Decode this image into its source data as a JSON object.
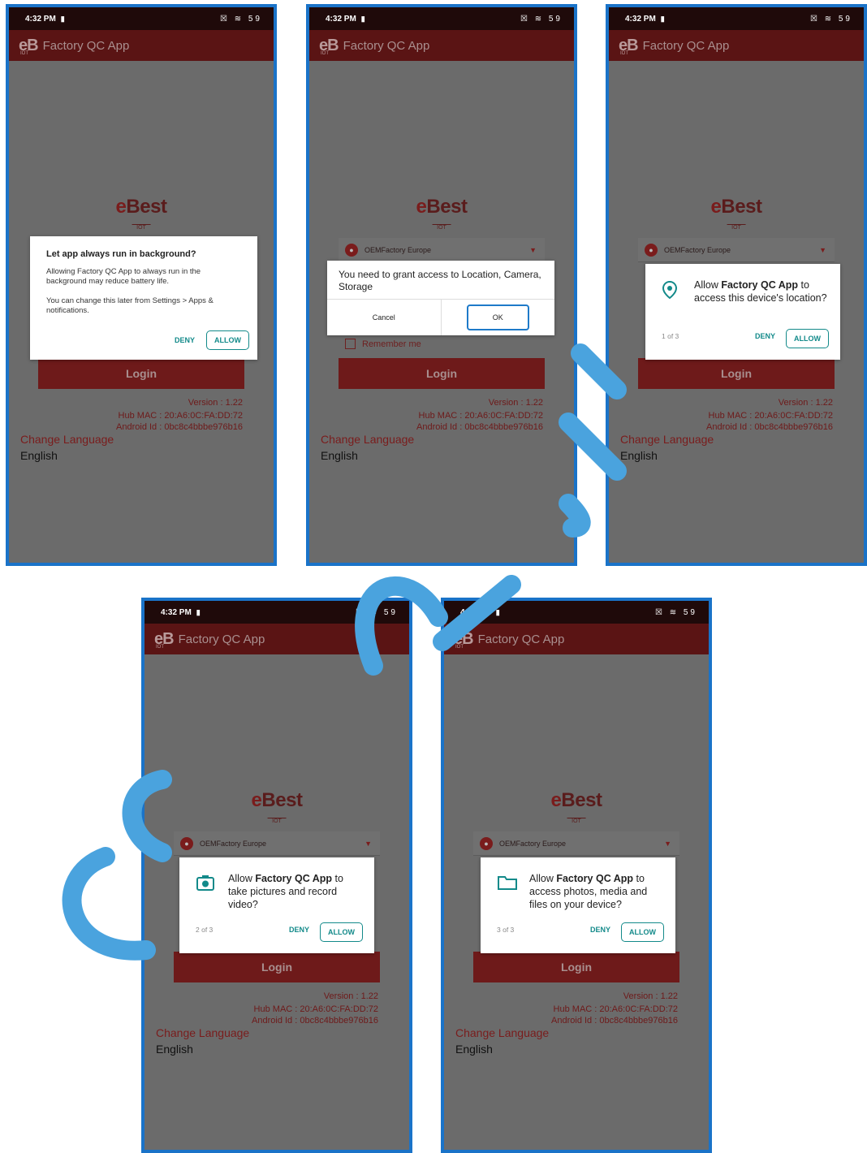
{
  "colors": {
    "frame": "#1a73c8",
    "appbar": "#5a1414",
    "accent": "#7a1c1c",
    "teal": "#138a8a",
    "watermark": "#4aa3de"
  },
  "phones": [
    {
      "time": "4:32 PM",
      "status_icons": "☒ ≋ 59",
      "app_title": "Factory QC App",
      "logo_text": "eBest",
      "logo_sub": "IOT",
      "login_label": "Login",
      "version": "Version : 1.22",
      "hub_mac": "Hub MAC : 20:A6:0C:FA:DD:72",
      "android_id": "Android Id : 0bc8c4bbbe976b16",
      "change_language": "Change Language",
      "language": "English",
      "dialog": {
        "title": "Let app always run in background?",
        "body": "Allowing Factory QC App to always run in the background may reduce battery life.",
        "body2": "You can change this later from Settings > Apps & notifications.",
        "deny": "DENY",
        "allow": "ALLOW"
      }
    },
    {
      "time": "4:32 PM",
      "status_icons": "☒ ≋ 59",
      "app_title": "Factory QC App",
      "logo_text": "eBest",
      "logo_sub": "IOT",
      "dropdown": "OEMFactory Europe",
      "remember_me": "Remember me",
      "login_label": "Login",
      "version": "Version : 1.22",
      "hub_mac": "Hub MAC : 20:A6:0C:FA:DD:72",
      "android_id": "Android Id : 0bc8c4bbbe976b16",
      "change_language": "Change Language",
      "language": "English",
      "dialog": {
        "message": "You need to grant access to Location, Camera, Storage",
        "cancel": "Cancel",
        "ok": "OK"
      }
    },
    {
      "time": "4:32 PM",
      "status_icons": "☒ ≋ 59",
      "app_title": "Factory QC App",
      "logo_text": "eBest",
      "logo_sub": "IOT",
      "dropdown": "OEMFactory Europe",
      "login_label": "Login",
      "version": "Version : 1.22",
      "hub_mac": "Hub MAC : 20:A6:0C:FA:DD:72",
      "android_id": "Android Id : 0bc8c4bbbe976b16",
      "change_language": "Change Language",
      "language": "English",
      "dialog": {
        "pre": "Allow ",
        "app": "Factory QC App",
        "post": " to access this device's location?",
        "count": "1 of 3",
        "deny": "DENY",
        "allow": "ALLOW"
      }
    },
    {
      "time": "4:32 PM",
      "status_icons": "☒ ≋ 59",
      "app_title": "Factory QC App",
      "logo_text": "eBest",
      "logo_sub": "IOT",
      "dropdown": "OEMFactory Europe",
      "login_label": "Login",
      "version": "Version : 1.22",
      "hub_mac": "Hub MAC : 20:A6:0C:FA:DD:72",
      "android_id": "Android Id : 0bc8c4bbbe976b16",
      "change_language": "Change Language",
      "language": "English",
      "dialog": {
        "pre": "Allow ",
        "app": "Factory QC App",
        "post": " to take pictures and record video?",
        "count": "2 of 3",
        "deny": "DENY",
        "allow": "ALLOW"
      }
    },
    {
      "time": "4:33 PM",
      "status_icons": "☒ ≋ 59",
      "app_title": "Factory QC App",
      "logo_text": "eBest",
      "logo_sub": "IOT",
      "dropdown": "OEMFactory Europe",
      "login_label": "Login",
      "version": "Version : 1.22",
      "hub_mac": "Hub MAC : 20:A6:0C:FA:DD:72",
      "android_id": "Android Id : 0bc8c4bbbe976b16",
      "change_language": "Change Language",
      "language": "English",
      "dialog": {
        "pre": "Allow ",
        "app": "Factory QC App",
        "post": " to access photos, media and files on your device?",
        "count": "3 of 3",
        "deny": "DENY",
        "allow": "ALLOW"
      }
    }
  ]
}
